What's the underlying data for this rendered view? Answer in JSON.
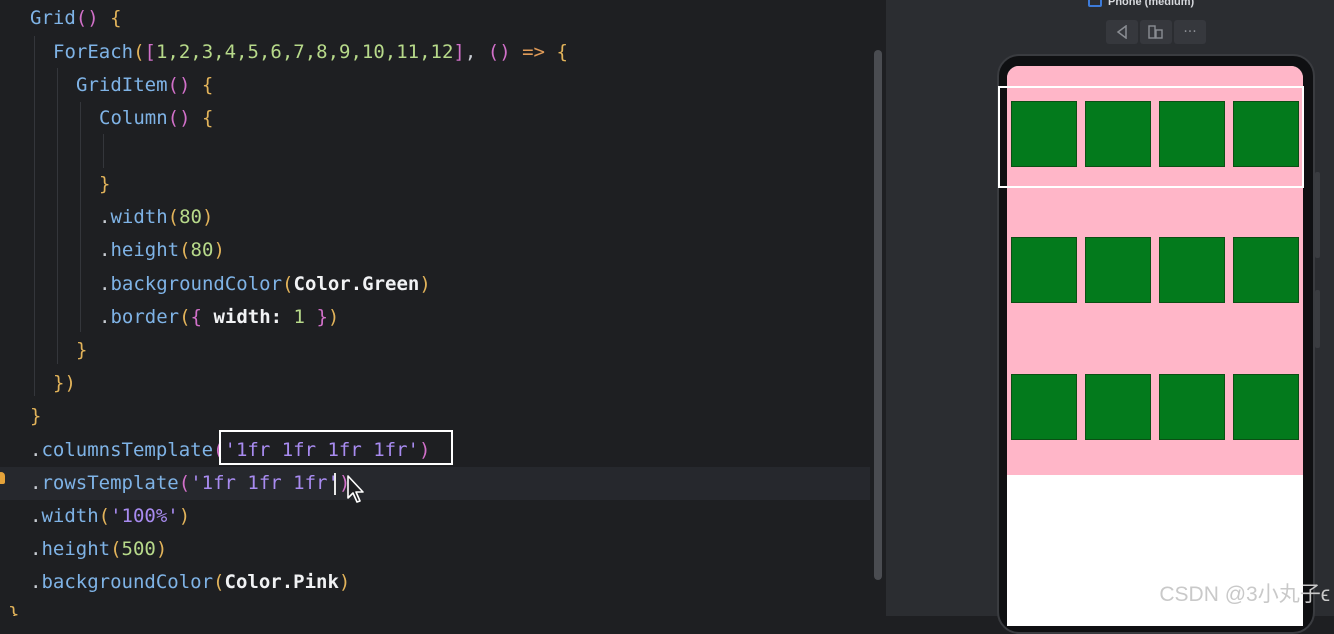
{
  "editor": {
    "lines": [
      [
        [
          "t-fn",
          "Grid"
        ],
        [
          "t-br2",
          "()"
        ],
        [
          "t-punc",
          " "
        ],
        [
          "t-br",
          "{"
        ]
      ],
      [
        [
          "t-fn",
          "ForEach"
        ],
        [
          "t-br",
          "("
        ],
        [
          "t-br2",
          "["
        ],
        [
          "t-num",
          "1,2,3,4,5,6,7,8,9,10,11,12"
        ],
        [
          "t-br2",
          "]"
        ],
        [
          "t-punc",
          ", "
        ],
        [
          "t-br2",
          "()"
        ],
        [
          "t-punc",
          " "
        ],
        [
          "t-op",
          "=>"
        ],
        [
          "t-punc",
          " "
        ],
        [
          "t-br",
          "{"
        ]
      ],
      [
        [
          "t-fn",
          "GridItem"
        ],
        [
          "t-br2",
          "()"
        ],
        [
          "t-punc",
          " "
        ],
        [
          "t-br",
          "{"
        ]
      ],
      [
        [
          "t-fn",
          "Column"
        ],
        [
          "t-br2",
          "()"
        ],
        [
          "t-punc",
          " "
        ],
        [
          "t-br",
          "{"
        ]
      ],
      [],
      [
        [
          "t-br",
          "}"
        ]
      ],
      [
        [
          "t-dot",
          "."
        ],
        [
          "t-meth",
          "width"
        ],
        [
          "t-br",
          "("
        ],
        [
          "t-num",
          "80"
        ],
        [
          "t-br",
          ")"
        ]
      ],
      [
        [
          "t-dot",
          "."
        ],
        [
          "t-meth",
          "height"
        ],
        [
          "t-br",
          "("
        ],
        [
          "t-num",
          "80"
        ],
        [
          "t-br",
          ")"
        ]
      ],
      [
        [
          "t-dot",
          "."
        ],
        [
          "t-meth",
          "backgroundColor"
        ],
        [
          "t-br",
          "("
        ],
        [
          "t-id",
          "Color.Green"
        ],
        [
          "t-br",
          ")"
        ]
      ],
      [
        [
          "t-dot",
          "."
        ],
        [
          "t-meth",
          "border"
        ],
        [
          "t-br",
          "("
        ],
        [
          "t-br2",
          "{"
        ],
        [
          "t-punc",
          " "
        ],
        [
          "t-id",
          "width:"
        ],
        [
          "t-punc",
          " "
        ],
        [
          "t-num",
          "1"
        ],
        [
          "t-punc",
          " "
        ],
        [
          "t-br2",
          "}"
        ],
        [
          "t-br",
          ")"
        ]
      ],
      [
        [
          "t-br",
          "}"
        ]
      ],
      [
        [
          "t-br",
          "})"
        ]
      ],
      [
        [
          "t-br",
          "}"
        ]
      ],
      [
        [
          "t-dot",
          "."
        ],
        [
          "t-meth",
          "columnsTemplate"
        ],
        [
          "t-br2",
          "("
        ],
        [
          "t-str",
          "'1fr 1fr 1fr 1fr'"
        ],
        [
          "t-br2",
          ")"
        ]
      ],
      [
        [
          "t-dot",
          "."
        ],
        [
          "t-meth",
          "rowsTemplate"
        ],
        [
          "t-br2",
          "("
        ],
        [
          "t-str",
          "'1fr 1fr 1fr"
        ],
        [
          "t-str",
          "'"
        ],
        [
          "t-br2",
          ")"
        ]
      ],
      [
        [
          "t-dot",
          "."
        ],
        [
          "t-meth",
          "width"
        ],
        [
          "t-br",
          "("
        ],
        [
          "t-str",
          "'100%'"
        ],
        [
          "t-br",
          ")"
        ]
      ],
      [
        [
          "t-dot",
          "."
        ],
        [
          "t-meth",
          "height"
        ],
        [
          "t-br",
          "("
        ],
        [
          "t-num",
          "500"
        ],
        [
          "t-br",
          ")"
        ]
      ],
      [
        [
          "t-dot",
          "."
        ],
        [
          "t-meth",
          "backgroundColor"
        ],
        [
          "t-br",
          "("
        ],
        [
          "t-id",
          "Color.Pink"
        ],
        [
          "t-br",
          ")"
        ]
      ],
      [
        [
          "t-br",
          "}"
        ]
      ]
    ]
  },
  "preview": {
    "device_label": "Phone (medium)",
    "toolbar": {
      "back_icon": "back-triangle-icon",
      "layout_icon": "component-tree-icon",
      "more_icon": "more-icon",
      "more_label": "···"
    },
    "grid": {
      "rows": 3,
      "columns": 4,
      "item_color": "#037a1c",
      "background_color": "#ffb6c8"
    }
  },
  "watermark": "CSDN @3小丸子ϵ"
}
